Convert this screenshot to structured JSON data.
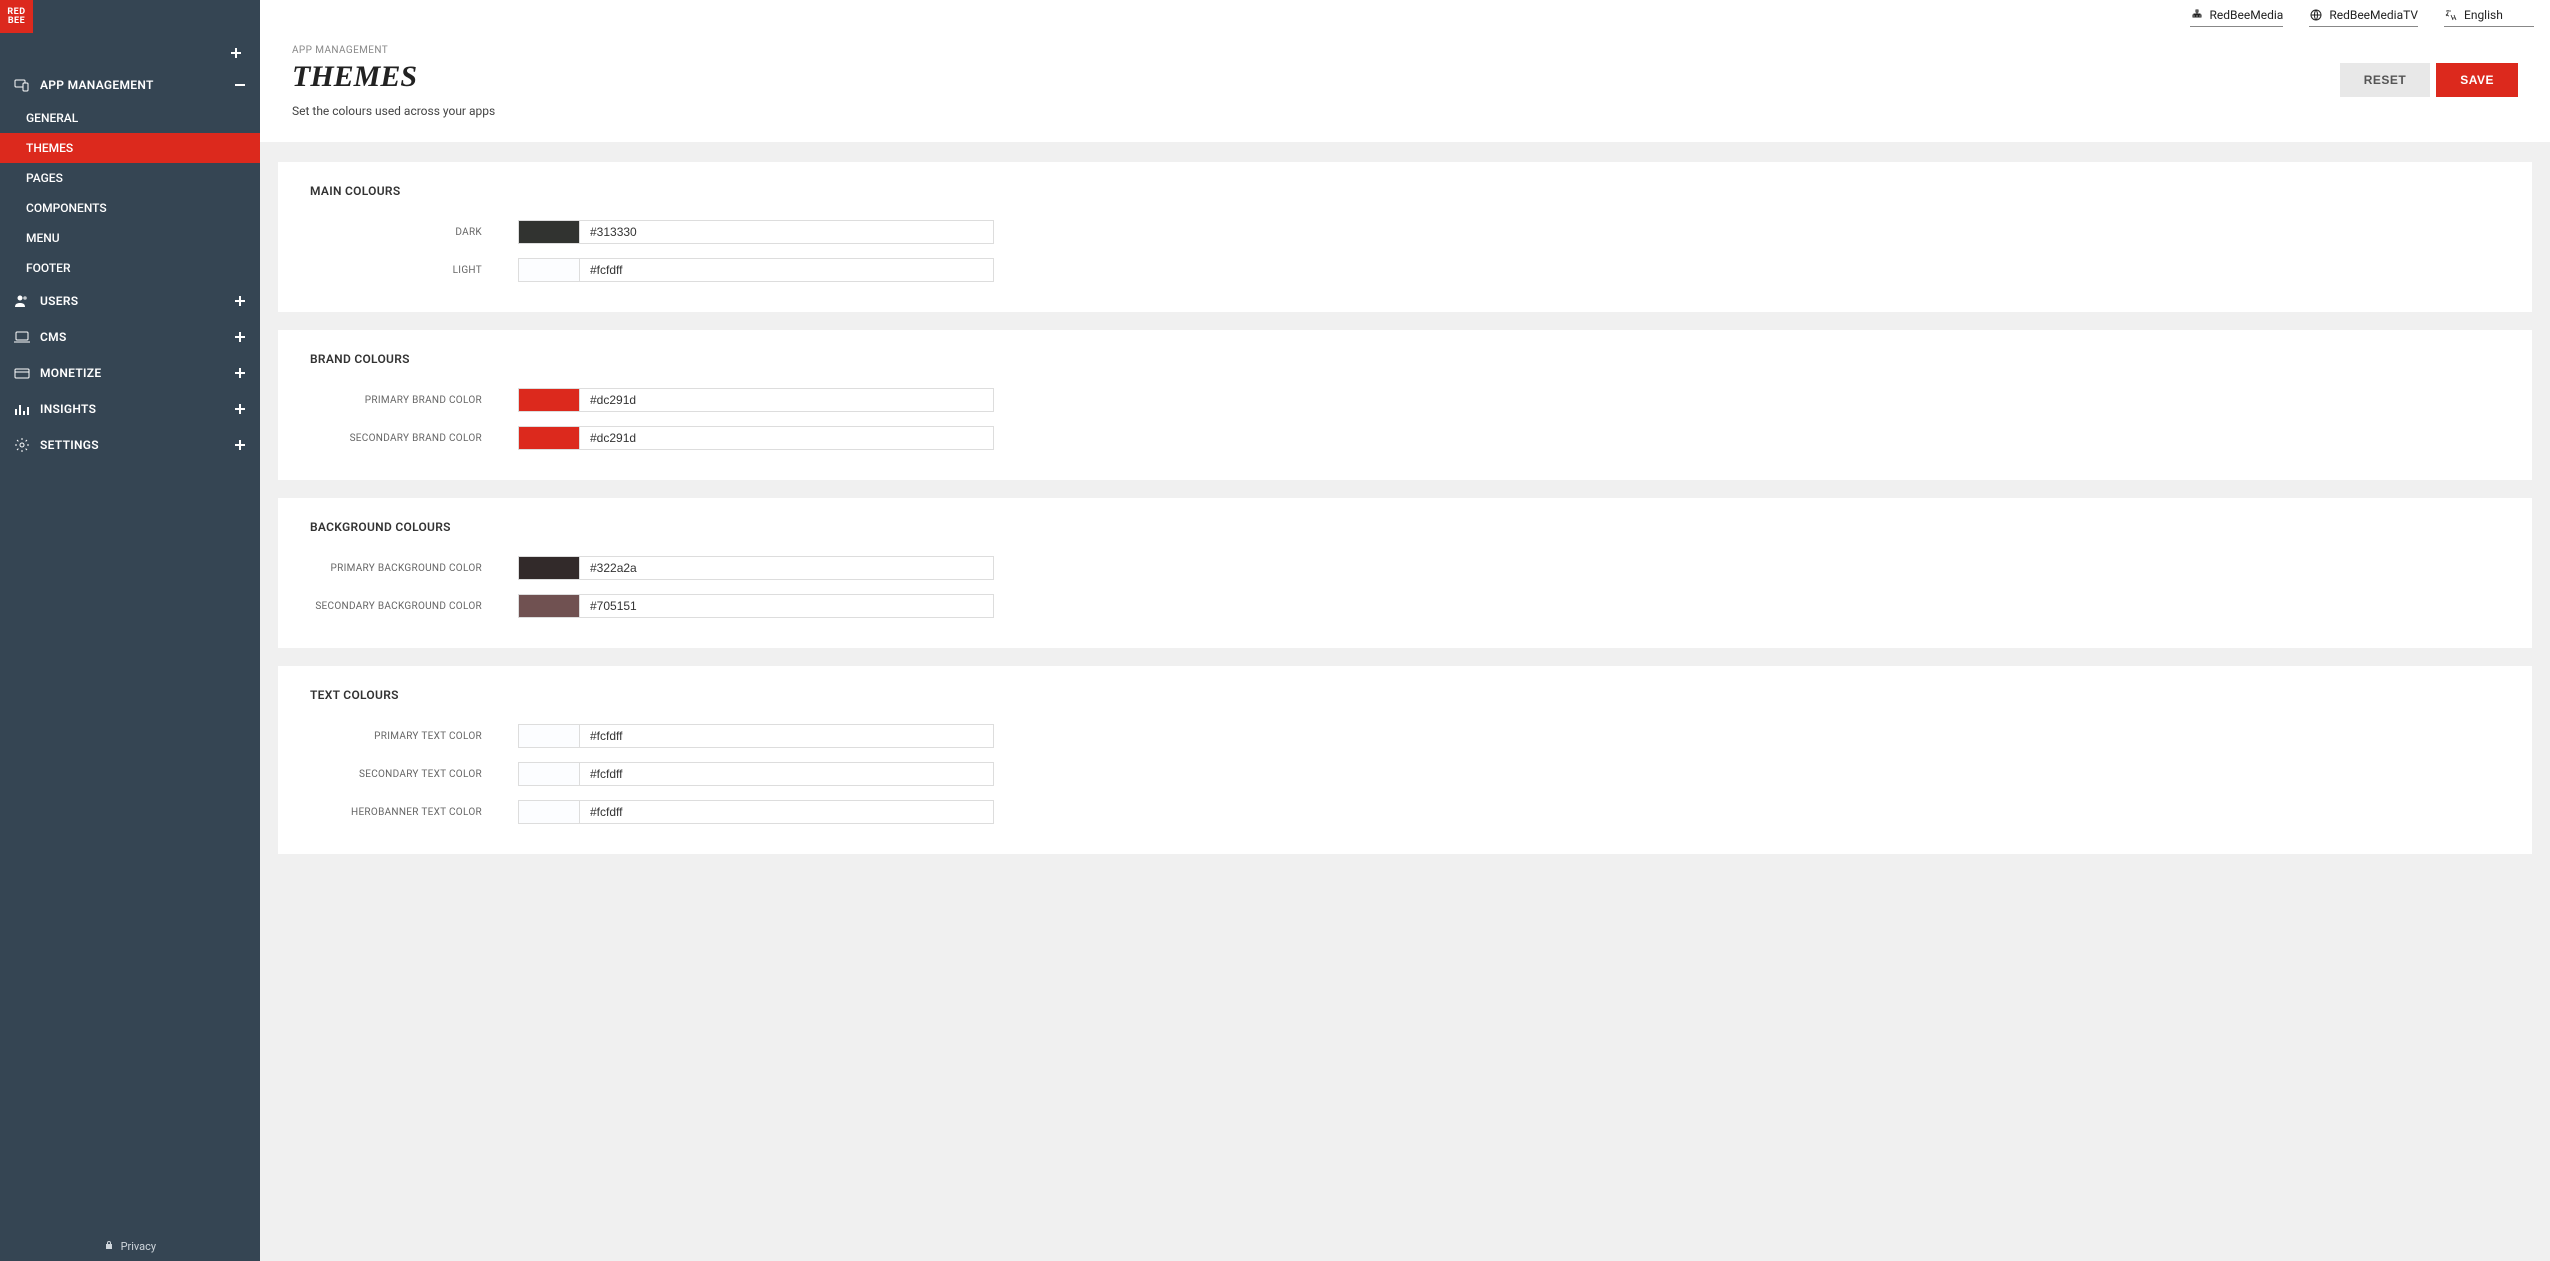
{
  "logo": {
    "line1": "RED",
    "line2": "BEE"
  },
  "sidebar": {
    "sections": [
      {
        "label": "APP MANAGEMENT",
        "icon": "devices-icon",
        "expanded": true,
        "items": [
          {
            "label": "GENERAL"
          },
          {
            "label": "THEMES",
            "active": true
          },
          {
            "label": "PAGES"
          },
          {
            "label": "COMPONENTS"
          },
          {
            "label": "MENU"
          },
          {
            "label": "FOOTER"
          }
        ]
      },
      {
        "label": "USERS",
        "icon": "users-icon",
        "expanded": false
      },
      {
        "label": "CMS",
        "icon": "laptop-icon",
        "expanded": false
      },
      {
        "label": "MONETIZE",
        "icon": "card-icon",
        "expanded": false
      },
      {
        "label": "INSIGHTS",
        "icon": "chart-icon",
        "expanded": false
      },
      {
        "label": "SETTINGS",
        "icon": "gear-icon",
        "expanded": false
      }
    ],
    "privacy": "Privacy"
  },
  "topbar": {
    "org": "RedBeeMedia",
    "product": "RedBeeMediaTV",
    "language": "English"
  },
  "page": {
    "breadcrumb": "APP MANAGEMENT",
    "title": "THEMES",
    "description": "Set the colours used across your apps",
    "reset": "RESET",
    "save": "SAVE"
  },
  "groups": [
    {
      "title": "MAIN COLOURS",
      "fields": [
        {
          "label": "DARK",
          "value": "#313330"
        },
        {
          "label": "LIGHT",
          "value": "#fcfdff"
        }
      ]
    },
    {
      "title": "BRAND COLOURS",
      "fields": [
        {
          "label": "PRIMARY BRAND COLOR",
          "value": "#dc291d"
        },
        {
          "label": "SECONDARY BRAND COLOR",
          "value": "#dc291d"
        }
      ]
    },
    {
      "title": "BACKGROUND COLOURS",
      "fields": [
        {
          "label": "PRIMARY BACKGROUND COLOR",
          "value": "#322a2a"
        },
        {
          "label": "SECONDARY BACKGROUND COLOR",
          "value": "#705151"
        }
      ]
    },
    {
      "title": "TEXT COLOURS",
      "fields": [
        {
          "label": "PRIMARY TEXT COLOR",
          "value": "#fcfdff"
        },
        {
          "label": "SECONDARY TEXT COLOR",
          "value": "#fcfdff"
        },
        {
          "label": "HEROBANNER TEXT COLOR",
          "value": "#fcfdff"
        }
      ]
    }
  ]
}
